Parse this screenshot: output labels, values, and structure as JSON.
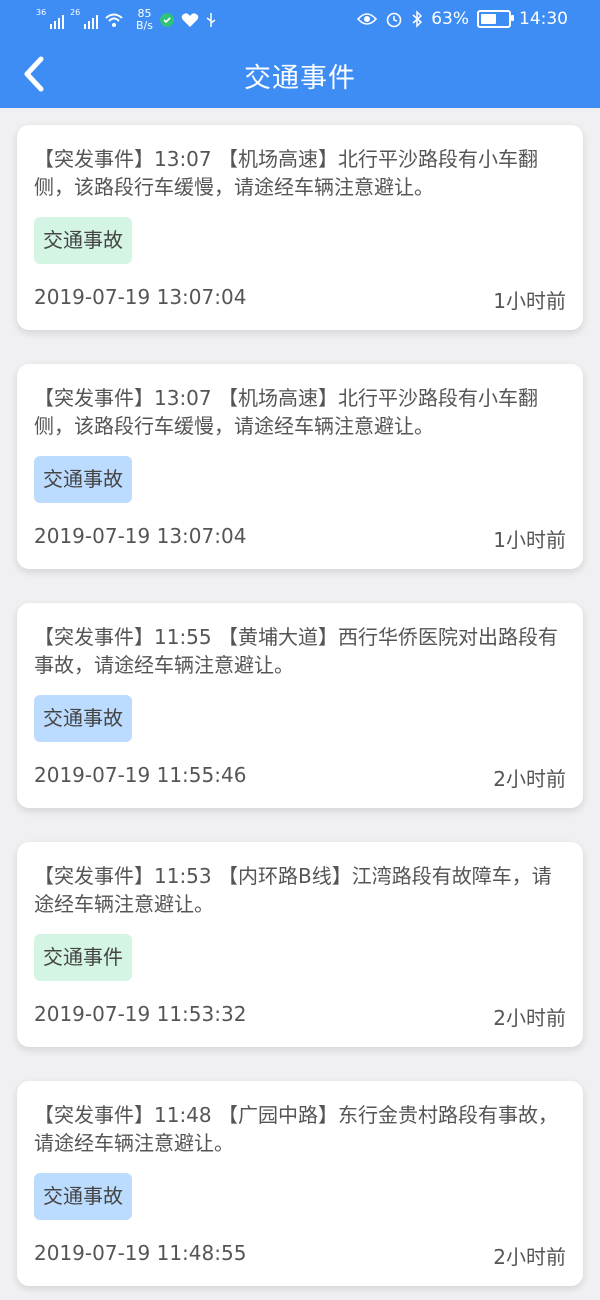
{
  "status_bar": {
    "signal1": "36",
    "signal2": "26",
    "net_speed_value": "85",
    "net_speed_unit": "B/s",
    "battery_percent": "63%",
    "battery_level": 0.63,
    "time": "14:30",
    "icons": [
      "signal-icon",
      "signal-icon",
      "wifi-icon",
      "app-icon",
      "health-icon",
      "usb-icon",
      "eye-icon",
      "alarm-icon",
      "bluetooth-icon",
      "battery-icon"
    ]
  },
  "header": {
    "title": "交通事件",
    "back_icon": "chevron-left-icon"
  },
  "colors": {
    "header_bg": "#3d8df5",
    "tag_green": "#d4f5e4",
    "tag_blue": "#bcdcff"
  },
  "events": [
    {
      "text": "【突发事件】13:07 【机场高速】北行平沙路段有小车翻侧，该路段行车缓慢，请途经车辆注意避让。",
      "tag": "交通事故",
      "tag_color": "green",
      "time": "2019-07-19 13:07:04",
      "ago": "1小时前"
    },
    {
      "text": "【突发事件】13:07 【机场高速】北行平沙路段有小车翻侧，该路段行车缓慢，请途经车辆注意避让。",
      "tag": "交通事故",
      "tag_color": "blue",
      "time": "2019-07-19 13:07:04",
      "ago": "1小时前"
    },
    {
      "text": "【突发事件】11:55 【黄埔大道】西行华侨医院对出路段有事故，请途经车辆注意避让。",
      "tag": "交通事故",
      "tag_color": "blue",
      "time": "2019-07-19 11:55:46",
      "ago": "2小时前"
    },
    {
      "text": "【突发事件】11:53 【内环路B线】江湾路段有故障车，请途经车辆注意避让。",
      "tag": "交通事件",
      "tag_color": "green",
      "time": "2019-07-19 11:53:32",
      "ago": "2小时前"
    },
    {
      "text": "【突发事件】11:48 【广园中路】东行金贵村路段有事故，请途经车辆注意避让。",
      "tag": "交通事故",
      "tag_color": "blue",
      "time": "2019-07-19 11:48:55",
      "ago": "2小时前"
    }
  ]
}
